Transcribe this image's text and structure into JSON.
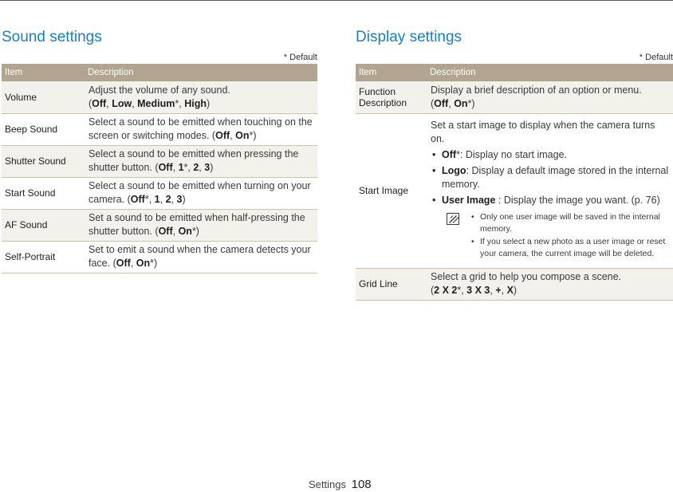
{
  "sound": {
    "title": "Sound settings",
    "default_note": "* Default",
    "headers": {
      "item": "Item",
      "description": "Description"
    },
    "rows": [
      {
        "item": "Volume",
        "desc": [
          "Adjust the volume of any sound.",
          "(",
          "Off",
          ", ",
          "Low",
          ", ",
          "Medium",
          "*, ",
          "High",
          ")"
        ]
      },
      {
        "item": "Beep Sound",
        "desc": [
          "Select a sound to be emitted when touching on the screen or switching modes. (",
          "Off",
          ", ",
          "On",
          "*)"
        ]
      },
      {
        "item": "Shutter Sound",
        "desc": [
          "Select a sound to be emitted when pressing the shutter button. (",
          "Off",
          ", ",
          "1",
          "*, ",
          "2",
          ", ",
          "3",
          ")"
        ]
      },
      {
        "item": "Start Sound",
        "desc": [
          "Select a sound to be emitted when turning on your camera. (",
          "Off",
          "*, ",
          "1",
          ", ",
          "2",
          ", ",
          "3",
          ")"
        ]
      },
      {
        "item": "AF Sound",
        "desc": [
          "Set a sound to be emitted when half-pressing the shutter button. (",
          "Off",
          ", ",
          "On",
          "*)"
        ]
      },
      {
        "item": "Self-Portrait",
        "desc": [
          "Set to emit a sound when the camera detects your face. (",
          "Off",
          ", ",
          "On",
          "*)"
        ]
      }
    ]
  },
  "display": {
    "title": "Display settings",
    "default_note": "* Default",
    "headers": {
      "item": "Item",
      "description": "Description"
    },
    "function_description": {
      "item_line1": "Function",
      "item_line2": "Description",
      "desc": [
        "Display a brief description of an option or menu.",
        "(",
        "Off",
        ", ",
        "On",
        "*)"
      ]
    },
    "start_image": {
      "item": "Start Image",
      "intro": "Set a start image to display when the camera turns on.",
      "options": [
        {
          "name": "Off",
          "text": "*: Display no start image."
        },
        {
          "name": "Logo",
          "text": ": Display a default image stored in the internal memory."
        },
        {
          "name": "User Image",
          "text": " : Display the image you want. (p. 76)"
        }
      ],
      "notes": [
        "Only one user image will be saved in the internal memory.",
        "If you select a new photo as a user image or reset your camera, the current image will be deleted."
      ],
      "note_icon": "note-pencil-icon"
    },
    "grid_line": {
      "item": "Grid Line",
      "desc": [
        "Select a grid to help you compose a scene.",
        "(",
        "2 X 2",
        "*, ",
        "3 X 3",
        ", ",
        "+",
        ", ",
        "X",
        ")"
      ]
    }
  },
  "footer": {
    "section": "Settings",
    "page": "108"
  },
  "colors": {
    "accent_title": "#1a7fc1",
    "header_bg": "#b1a58f",
    "row_shade": "#f3f1ec"
  }
}
